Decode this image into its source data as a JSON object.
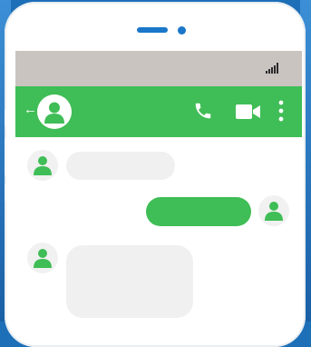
{
  "colors": {
    "accent_green": "#3fbd56",
    "status_bar_gray": "#c9c4c0",
    "incoming_bubble": "#f0f0f0",
    "background_blue": "#1d6fb8"
  },
  "status_bar": {
    "signal_icon": "signal-bars-icon"
  },
  "app_bar": {
    "back_icon": "back-arrow-icon",
    "back_glyph": "←",
    "contact_icon": "contact-avatar-icon",
    "actions": [
      "phone-call-icon",
      "video-call-icon",
      "more-options-icon"
    ]
  },
  "chat": {
    "messages": [
      {
        "direction": "incoming",
        "text": ""
      },
      {
        "direction": "outgoing",
        "text": ""
      },
      {
        "direction": "incoming",
        "text": ""
      }
    ]
  }
}
